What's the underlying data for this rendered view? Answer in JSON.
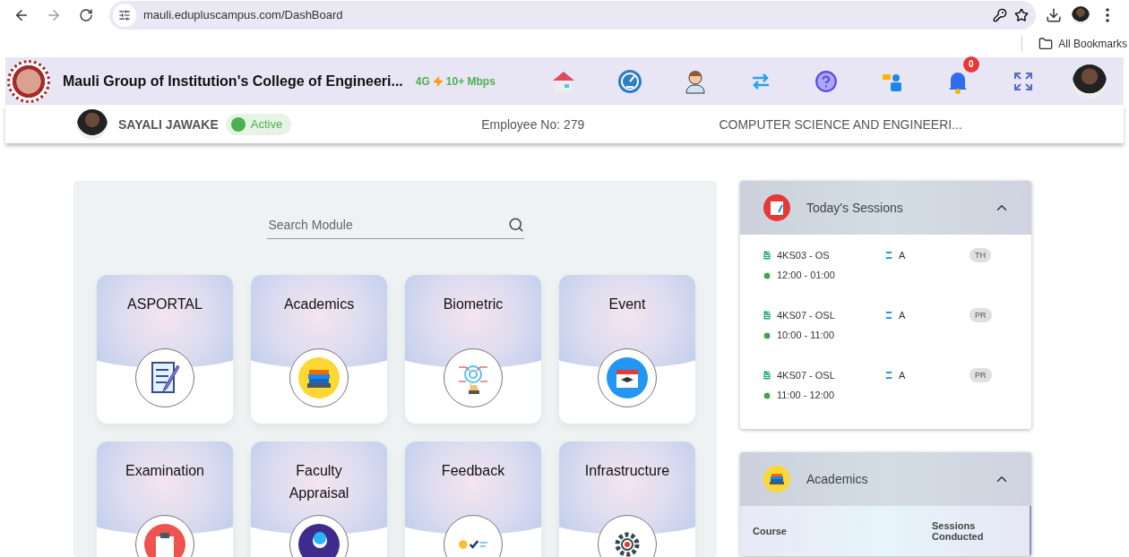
{
  "browser": {
    "url": "mauli.edupluscampus.com/DashBoard",
    "bookmarks_label": "All Bookmarks"
  },
  "header": {
    "college": "Mauli Group of Institution's College of Engineeri...",
    "network": "4G",
    "speed": "10+ Mbps",
    "notification_count": "0"
  },
  "profile": {
    "name": "SAYALI JAWAKE",
    "status": "Active",
    "employee_label": "Employee No:",
    "employee_no": "279",
    "department": "COMPUTER SCIENCE AND ENGINEERI..."
  },
  "search": {
    "placeholder": "Search Module"
  },
  "modules": [
    {
      "label": "ASPORTAL",
      "kind": "checklist"
    },
    {
      "label": "Academics",
      "kind": "books"
    },
    {
      "label": "Biometric",
      "kind": "fingerprint"
    },
    {
      "label": "Event",
      "kind": "calendar"
    },
    {
      "label": "Examination",
      "kind": "clipboard"
    },
    {
      "label": "Faculty Appraisal",
      "kind": "person"
    },
    {
      "label": "Feedback",
      "kind": "feedback"
    },
    {
      "label": "Infrastructure",
      "kind": "gear"
    }
  ],
  "sessions": {
    "title": "Today's Sessions",
    "expanded": true,
    "items": [
      {
        "course": "4KS03 - OS",
        "division": "A",
        "type": "TH",
        "time": "12:00 - 01:00"
      },
      {
        "course": "4KS07 - OSL",
        "division": "A",
        "type": "PR",
        "time": "10:00 - 11:00"
      },
      {
        "course": "4KS07 - OSL",
        "division": "A",
        "type": "PR",
        "time": "11:00 - 12:00"
      }
    ]
  },
  "academics": {
    "title": "Academics",
    "expanded": true,
    "columns": [
      "Course",
      "Sessions Conducted"
    ]
  }
}
